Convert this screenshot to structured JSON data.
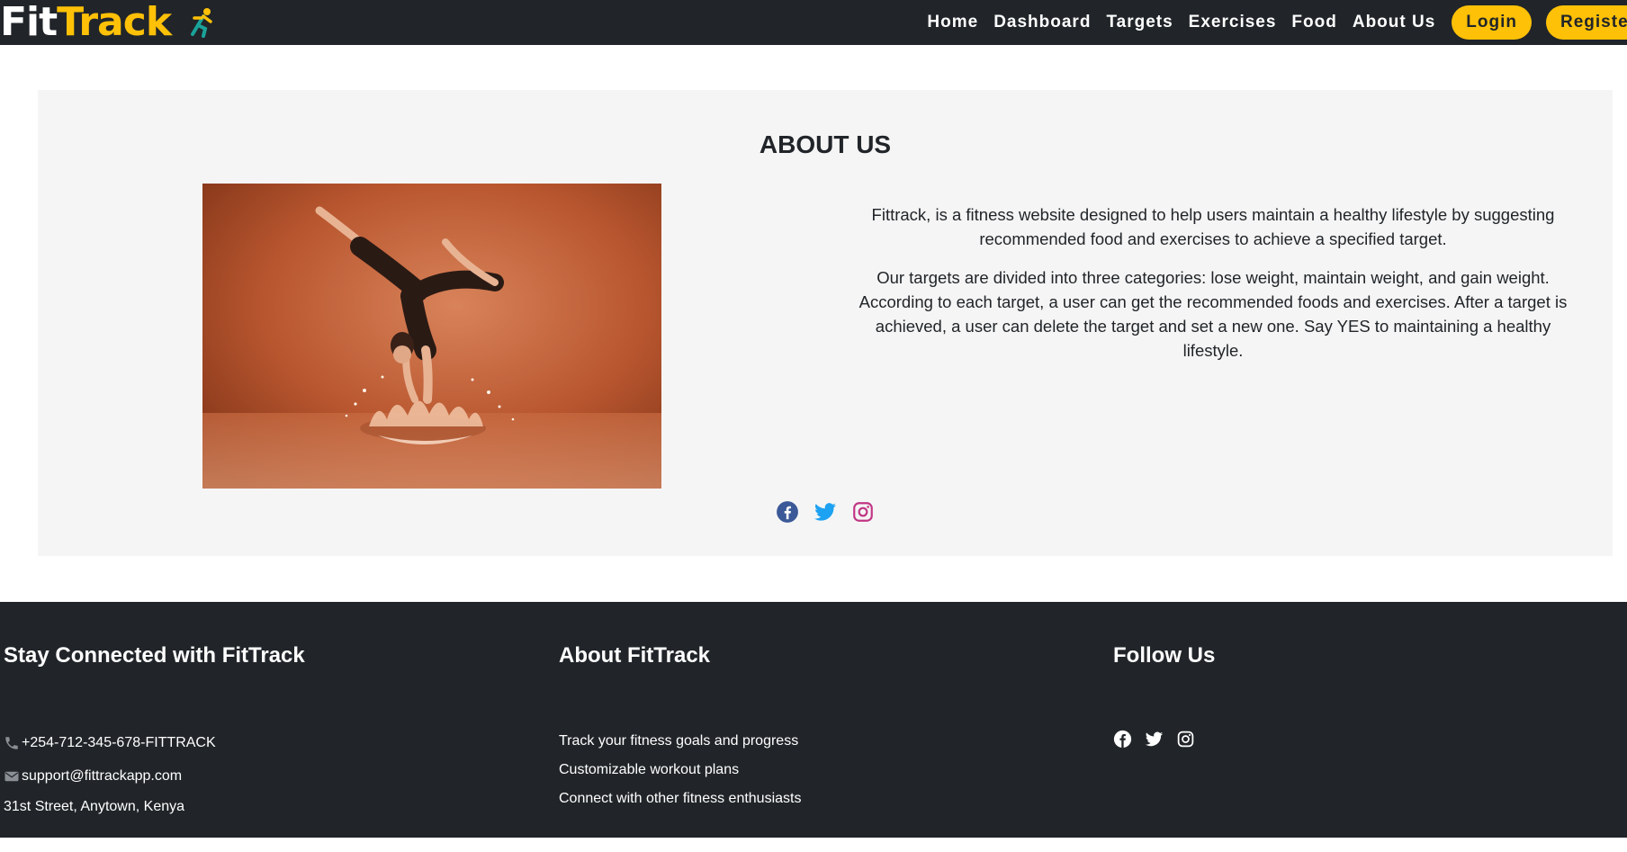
{
  "brand": {
    "part1": "Fit",
    "part2": "Track",
    "icon": "runner-icon"
  },
  "nav": {
    "links": [
      "Home",
      "Dashboard",
      "Targets",
      "Exercises",
      "Food",
      "About Us"
    ],
    "login_label": "Login",
    "register_label": "Register"
  },
  "about": {
    "title": "ABOUT US",
    "image_icon": "handstand-splash-photo",
    "paragraph1": "Fittrack, is a fitness website designed to help users maintain a healthy lifestyle by suggesting recommended food and exercises to achieve a specified target.",
    "paragraph2": "Our targets are divided into three categories: lose weight, maintain weight, and gain weight. According to each target, a user can get the recommended foods and exercises. After a target is achieved, a user can delete the target and set a new one. Say YES to maintaining a healthy lifestyle.",
    "social_icons": [
      "facebook-icon",
      "twitter-icon",
      "instagram-icon"
    ]
  },
  "footer": {
    "col1": {
      "title": "Stay Connected with FitTrack",
      "phone": "+254-712-345-678-FITTRACK",
      "email": "support@fittrackapp.com",
      "address": "31st Street, Anytown, Kenya"
    },
    "col2": {
      "title": "About FitTrack",
      "items": [
        "Track your fitness goals and progress",
        "Customizable workout plans",
        "Connect with other fitness enthusiasts"
      ]
    },
    "col3": {
      "title": "Follow Us"
    }
  },
  "colors": {
    "dark": "#212529",
    "accent": "#ffc107",
    "section_bg": "#f5f5f5",
    "facebook": "#3b5998",
    "twitter": "#1da1f2",
    "instagram": "#c13584"
  }
}
